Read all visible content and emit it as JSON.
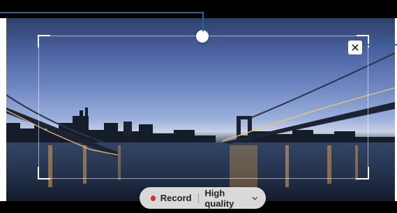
{
  "toolbar": {
    "record_label": "Record",
    "quality_label": "High quality"
  },
  "icons": {
    "close": "close-icon",
    "record": "record-dot-icon",
    "dropdown": "chevron-down-icon",
    "resize": "resize-handle"
  },
  "colors": {
    "record_dot": "#d63030",
    "callout": "#1b6aa8",
    "toolbar_bg": "#d9d9d9"
  }
}
